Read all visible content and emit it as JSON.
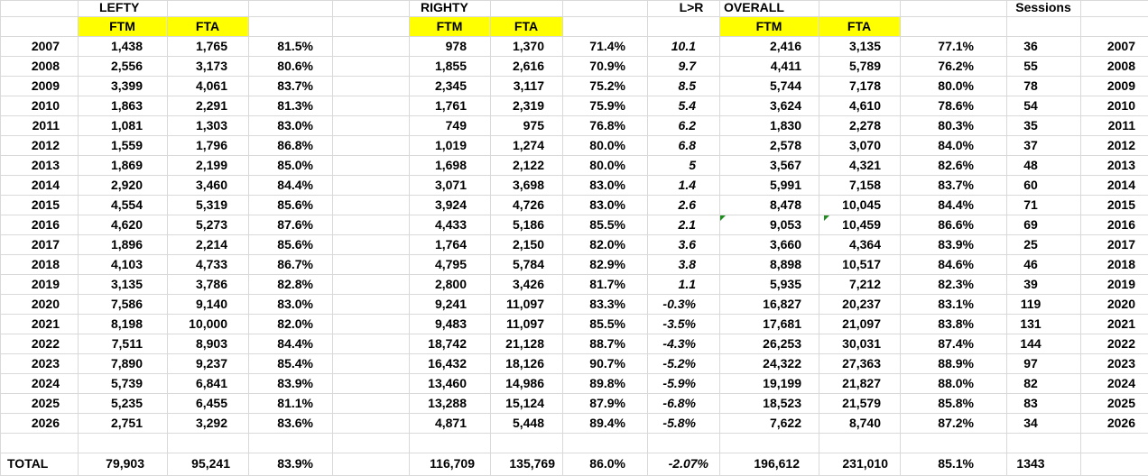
{
  "headers": {
    "lefty": "LEFTY",
    "righty": "RIGHTY",
    "lr": "L>R",
    "overall": "OVERALL",
    "sessions": "Sessions",
    "ftm": "FTM",
    "fta": "FTA"
  },
  "highlight_color": "#ffff00",
  "error_marker_color": "#1e8c1e",
  "rows": [
    {
      "year": "2007",
      "l_ftm": "1,438",
      "l_fta": "1,765",
      "l_pct": "81.5%",
      "r_ftm": "978",
      "r_fta": "1,370",
      "r_pct": "71.4%",
      "lr": "10.1",
      "o_ftm": "2,416",
      "o_fta": "3,135",
      "o_pct": "77.1%",
      "sessions": "36",
      "year2": "2007"
    },
    {
      "year": "2008",
      "l_ftm": "2,556",
      "l_fta": "3,173",
      "l_pct": "80.6%",
      "r_ftm": "1,855",
      "r_fta": "2,616",
      "r_pct": "70.9%",
      "lr": "9.7",
      "o_ftm": "4,411",
      "o_fta": "5,789",
      "o_pct": "76.2%",
      "sessions": "55",
      "year2": "2008"
    },
    {
      "year": "2009",
      "l_ftm": "3,399",
      "l_fta": "4,061",
      "l_pct": "83.7%",
      "r_ftm": "2,345",
      "r_fta": "3,117",
      "r_pct": "75.2%",
      "lr": "8.5",
      "o_ftm": "5,744",
      "o_fta": "7,178",
      "o_pct": "80.0%",
      "sessions": "78",
      "year2": "2009"
    },
    {
      "year": "2010",
      "l_ftm": "1,863",
      "l_fta": "2,291",
      "l_pct": "81.3%",
      "r_ftm": "1,761",
      "r_fta": "2,319",
      "r_pct": "75.9%",
      "lr": "5.4",
      "o_ftm": "3,624",
      "o_fta": "4,610",
      "o_pct": "78.6%",
      "sessions": "54",
      "year2": "2010"
    },
    {
      "year": "2011",
      "l_ftm": "1,081",
      "l_fta": "1,303",
      "l_pct": "83.0%",
      "r_ftm": "749",
      "r_fta": "975",
      "r_pct": "76.8%",
      "lr": "6.2",
      "o_ftm": "1,830",
      "o_fta": "2,278",
      "o_pct": "80.3%",
      "sessions": "35",
      "year2": "2011"
    },
    {
      "year": "2012",
      "l_ftm": "1,559",
      "l_fta": "1,796",
      "l_pct": "86.8%",
      "r_ftm": "1,019",
      "r_fta": "1,274",
      "r_pct": "80.0%",
      "lr": "6.8",
      "o_ftm": "2,578",
      "o_fta": "3,070",
      "o_pct": "84.0%",
      "sessions": "37",
      "year2": "2012"
    },
    {
      "year": "2013",
      "l_ftm": "1,869",
      "l_fta": "2,199",
      "l_pct": "85.0%",
      "r_ftm": "1,698",
      "r_fta": "2,122",
      "r_pct": "80.0%",
      "lr": "5",
      "o_ftm": "3,567",
      "o_fta": "4,321",
      "o_pct": "82.6%",
      "sessions": "48",
      "year2": "2013"
    },
    {
      "year": "2014",
      "l_ftm": "2,920",
      "l_fta": "3,460",
      "l_pct": "84.4%",
      "r_ftm": "3,071",
      "r_fta": "3,698",
      "r_pct": "83.0%",
      "lr": "1.4",
      "o_ftm": "5,991",
      "o_fta": "7,158",
      "o_pct": "83.7%",
      "sessions": "60",
      "year2": "2014"
    },
    {
      "year": "2015",
      "l_ftm": "4,554",
      "l_fta": "5,319",
      "l_pct": "85.6%",
      "r_ftm": "3,924",
      "r_fta": "4,726",
      "r_pct": "83.0%",
      "lr": "2.6",
      "o_ftm": "8,478",
      "o_fta": "10,045",
      "o_pct": "84.4%",
      "sessions": "71",
      "year2": "2015"
    },
    {
      "year": "2016",
      "l_ftm": "4,620",
      "l_fta": "5,273",
      "l_pct": "87.6%",
      "r_ftm": "4,433",
      "r_fta": "5,186",
      "r_pct": "85.5%",
      "lr": "2.1",
      "o_ftm": "9,053",
      "o_fta": "10,459",
      "o_pct": "86.6%",
      "sessions": "69",
      "year2": "2016"
    },
    {
      "year": "2017",
      "l_ftm": "1,896",
      "l_fta": "2,214",
      "l_pct": "85.6%",
      "r_ftm": "1,764",
      "r_fta": "2,150",
      "r_pct": "82.0%",
      "lr": "3.6",
      "o_ftm": "3,660",
      "o_fta": "4,364",
      "o_pct": "83.9%",
      "sessions": "25",
      "year2": "2017"
    },
    {
      "year": "2018",
      "l_ftm": "4,103",
      "l_fta": "4,733",
      "l_pct": "86.7%",
      "r_ftm": "4,795",
      "r_fta": "5,784",
      "r_pct": "82.9%",
      "lr": "3.8",
      "o_ftm": "8,898",
      "o_fta": "10,517",
      "o_pct": "84.6%",
      "sessions": "46",
      "year2": "2018"
    },
    {
      "year": "2019",
      "l_ftm": "3,135",
      "l_fta": "3,786",
      "l_pct": "82.8%",
      "r_ftm": "2,800",
      "r_fta": "3,426",
      "r_pct": "81.7%",
      "lr": "1.1",
      "o_ftm": "5,935",
      "o_fta": "7,212",
      "o_pct": "82.3%",
      "sessions": "39",
      "year2": "2019"
    },
    {
      "year": "2020",
      "l_ftm": "7,586",
      "l_fta": "9,140",
      "l_pct": "83.0%",
      "r_ftm": "9,241",
      "r_fta": "11,097",
      "r_pct": "83.3%",
      "lr": "-0.3%",
      "o_ftm": "16,827",
      "o_fta": "20,237",
      "o_pct": "83.1%",
      "sessions": "119",
      "year2": "2020"
    },
    {
      "year": "2021",
      "l_ftm": "8,198",
      "l_fta": "10,000",
      "l_pct": "82.0%",
      "r_ftm": "9,483",
      "r_fta": "11,097",
      "r_pct": "85.5%",
      "lr": "-3.5%",
      "o_ftm": "17,681",
      "o_fta": "21,097",
      "o_pct": "83.8%",
      "sessions": "131",
      "year2": "2021"
    },
    {
      "year": "2022",
      "l_ftm": "7,511",
      "l_fta": "8,903",
      "l_pct": "84.4%",
      "r_ftm": "18,742",
      "r_fta": "21,128",
      "r_pct": "88.7%",
      "lr": "-4.3%",
      "o_ftm": "26,253",
      "o_fta": "30,031",
      "o_pct": "87.4%",
      "sessions": "144",
      "year2": "2022"
    },
    {
      "year": "2023",
      "l_ftm": "7,890",
      "l_fta": "9,237",
      "l_pct": "85.4%",
      "r_ftm": "16,432",
      "r_fta": "18,126",
      "r_pct": "90.7%",
      "lr": "-5.2%",
      "o_ftm": "24,322",
      "o_fta": "27,363",
      "o_pct": "88.9%",
      "sessions": "97",
      "year2": "2023"
    },
    {
      "year": "2024",
      "l_ftm": "5,739",
      "l_fta": "6,841",
      "l_pct": "83.9%",
      "r_ftm": "13,460",
      "r_fta": "14,986",
      "r_pct": "89.8%",
      "lr": "-5.9%",
      "o_ftm": "19,199",
      "o_fta": "21,827",
      "o_pct": "88.0%",
      "sessions": "82",
      "year2": "2024"
    },
    {
      "year": "2025",
      "l_ftm": "5,235",
      "l_fta": "6,455",
      "l_pct": "81.1%",
      "r_ftm": "13,288",
      "r_fta": "15,124",
      "r_pct": "87.9%",
      "lr": "-6.8%",
      "o_ftm": "18,523",
      "o_fta": "21,579",
      "o_pct": "85.8%",
      "sessions": "83",
      "year2": "2025"
    },
    {
      "year": "2026",
      "l_ftm": "2,751",
      "l_fta": "3,292",
      "l_pct": "83.6%",
      "r_ftm": "4,871",
      "r_fta": "5,448",
      "r_pct": "89.4%",
      "lr": "-5.8%",
      "o_ftm": "7,622",
      "o_fta": "8,740",
      "o_pct": "87.2%",
      "sessions": "34",
      "year2": "2026"
    }
  ],
  "total": {
    "label": "TOTAL",
    "l_ftm": "79,903",
    "l_fta": "95,241",
    "l_pct": "83.9%",
    "r_ftm": "116,709",
    "r_fta": "135,769",
    "r_pct": "86.0%",
    "lr": "-2.07%",
    "o_ftm": "196,612",
    "o_fta": "231,010",
    "o_pct": "85.1%",
    "sessions": "1343"
  }
}
